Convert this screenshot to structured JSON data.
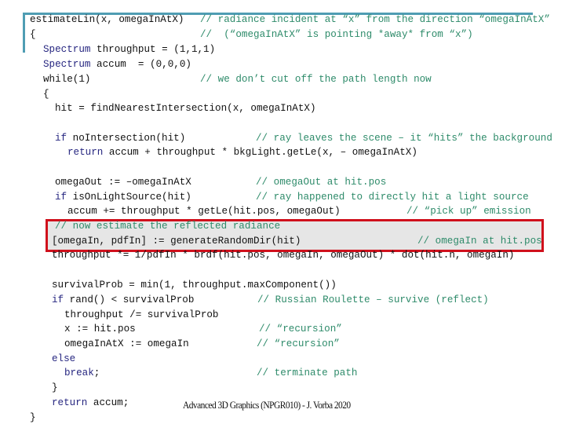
{
  "slide": {
    "accent_color": "#4f9db3",
    "highlight_border_color": "#d0101c",
    "highlight_fill_color": "#e6e6e6",
    "keyword_color": "#262680",
    "comment_color": "#2e8b6a",
    "footer": "Advanced 3D Graphics (NPGR010) - J. Vorba 2020"
  },
  "code": {
    "l01": {
      "code": "estimateLin(x, omegaInAtX)",
      "comment": "// radiance incident at “x” from the direction “omegaInAtX”"
    },
    "l02": {
      "code": "{",
      "comment": "//  (“omegaInAtX” is pointing *away* from “x”)"
    },
    "l03": {
      "kw": "Spectrum",
      "code": " throughput = (1,1,1)"
    },
    "l04": {
      "kw": "Spectrum",
      "code": " accum  = (0,0,0)"
    },
    "l05": {
      "code": "while(1)",
      "comment": "// we don’t cut off the path length now"
    },
    "l06": {
      "code": "{"
    },
    "l07": {
      "code": "hit = findNearestIntersection(x, omegaInAtX)"
    },
    "l08": {
      "kw": "if",
      "code": " noIntersection(hit)",
      "comment": "// ray leaves the scene – it “hits” the background"
    },
    "l09": {
      "kw": "return",
      "code": " accum + throughput * bkgLight.getLe(x, – omegaInAtX)"
    },
    "l10": {
      "code": "omegaOut := –omegaInAtX",
      "comment": "// omegaOut at hit.pos"
    },
    "l11": {
      "kw": "if",
      "code": " isOnLightSource(hit)",
      "comment": "// ray happened to directly hit a light source"
    },
    "l12": {
      "code": "accum += throughput * getLe(hit.pos, omegaOut)",
      "comment": "// “pick up” emission"
    },
    "l13": {
      "comment": "// now estimate the reflected radiance"
    },
    "l14": {
      "code": "[omegaIn, pdfIn] := generateRandomDir(hit)",
      "comment": "// omegaIn at hit.pos"
    },
    "l15": {
      "code": "throughput *= 1/pdfIn * brdf(hit.pos, omegaIn, omegaOut) * dot(hit.n, omegaIn)"
    },
    "l16": {
      "code": "survivalProb = min(1, throughput.maxComponent())"
    },
    "l17": {
      "kw": "if",
      "code": " rand() < survivalProb",
      "comment": "// Russian Roulette – survive (reflect)"
    },
    "l18": {
      "code": "throughput /= survivalProb"
    },
    "l19": {
      "code": "x := hit.pos",
      "comment": "// “recursion”"
    },
    "l20": {
      "code": "omegaInAtX := omegaIn",
      "comment": "// “recursion”"
    },
    "l21": {
      "kw": "else"
    },
    "l22": {
      "kw": "break",
      "code": ";",
      "comment": "// terminate path"
    },
    "l23": {
      "code": "}"
    },
    "l24": {
      "kw": "return",
      "code": " accum;"
    },
    "l25": {
      "code": "}"
    }
  }
}
